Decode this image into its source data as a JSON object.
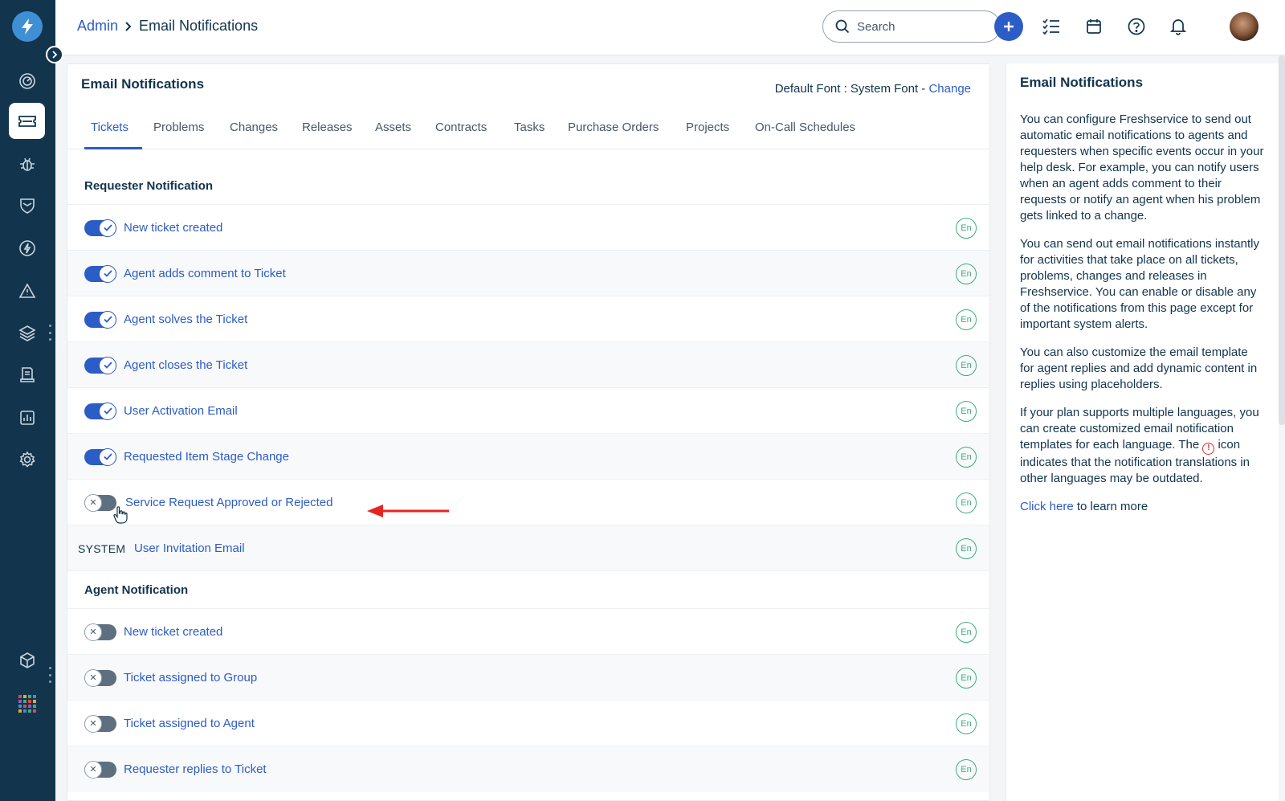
{
  "sidebar": {
    "items": [
      {
        "icon": "dashboard-icon"
      },
      {
        "icon": "ticket-icon",
        "active": true
      },
      {
        "icon": "bug-icon"
      },
      {
        "icon": "shield-icon"
      },
      {
        "icon": "lightning-icon"
      },
      {
        "icon": "alert-triangle-icon"
      },
      {
        "icon": "layers-icon"
      },
      {
        "icon": "document-icon"
      },
      {
        "icon": "reports-icon"
      },
      {
        "icon": "settings-icon"
      },
      {
        "icon": "cube-icon"
      },
      {
        "icon": "apps-grid-icon"
      }
    ]
  },
  "header": {
    "breadcrumb_parent": "Admin",
    "breadcrumb_current": "Email Notifications",
    "search_placeholder": "Search"
  },
  "main": {
    "title": "Email Notifications",
    "font_label": "Default Font : System Font - ",
    "font_change": "Change",
    "tabs": [
      "Tickets",
      "Problems",
      "Changes",
      "Releases",
      "Assets",
      "Contracts",
      "Tasks",
      "Purchase Orders",
      "Projects",
      "On-Call Schedules"
    ],
    "requester_section": "Requester Notification",
    "requester_rows": [
      {
        "label": "New ticket created",
        "enabled": true,
        "lang": "En"
      },
      {
        "label": "Agent adds comment to Ticket",
        "enabled": true,
        "lang": "En"
      },
      {
        "label": "Agent solves the Ticket",
        "enabled": true,
        "lang": "En"
      },
      {
        "label": "Agent closes the Ticket",
        "enabled": true,
        "lang": "En"
      },
      {
        "label": "User Activation Email",
        "enabled": true,
        "lang": "En"
      },
      {
        "label": "Requested Item Stage Change",
        "enabled": true,
        "lang": "En"
      },
      {
        "label": "Service Request Approved or Rejected",
        "enabled": false,
        "lang": "En"
      }
    ],
    "system_row": {
      "tag": "SYSTEM",
      "label": "User Invitation Email",
      "lang": "En"
    },
    "agent_section": "Agent Notification",
    "agent_rows": [
      {
        "label": "New ticket created",
        "enabled": false,
        "lang": "En"
      },
      {
        "label": "Ticket assigned to Group",
        "enabled": false,
        "lang": "En"
      },
      {
        "label": "Ticket assigned to Agent",
        "enabled": false,
        "lang": "En"
      },
      {
        "label": "Requester replies to Ticket",
        "enabled": false,
        "lang": "En"
      }
    ]
  },
  "help": {
    "title": "Email Notifications",
    "p1": "You can configure Freshservice to send out automatic email notifications to agents and requesters when specific events occur in your help desk. For example, you can notify users when an agent adds comment to their requests or notify an agent when his problem gets linked to a change.",
    "p2": "You can send out email notifications instantly for activities that take place on all tickets, problems, changes and releases in Freshservice. You can enable or disable any of the notifications from this page except for important system alerts.",
    "p3": "You can also customize the email template for agent replies and add dynamic content in replies using placeholders.",
    "p4_before": "If your plan supports multiple languages, you can create customized email notification templates for each language. The ",
    "p4_after": " icon indicates that the notification translations in other languages may be outdated.",
    "link": "Click here",
    "link_after": " to learn more"
  },
  "colors": {
    "accent": "#2c5cc5",
    "sidebar": "#12344d",
    "badge": "#3dae7e",
    "annotation": "#e8241e"
  }
}
